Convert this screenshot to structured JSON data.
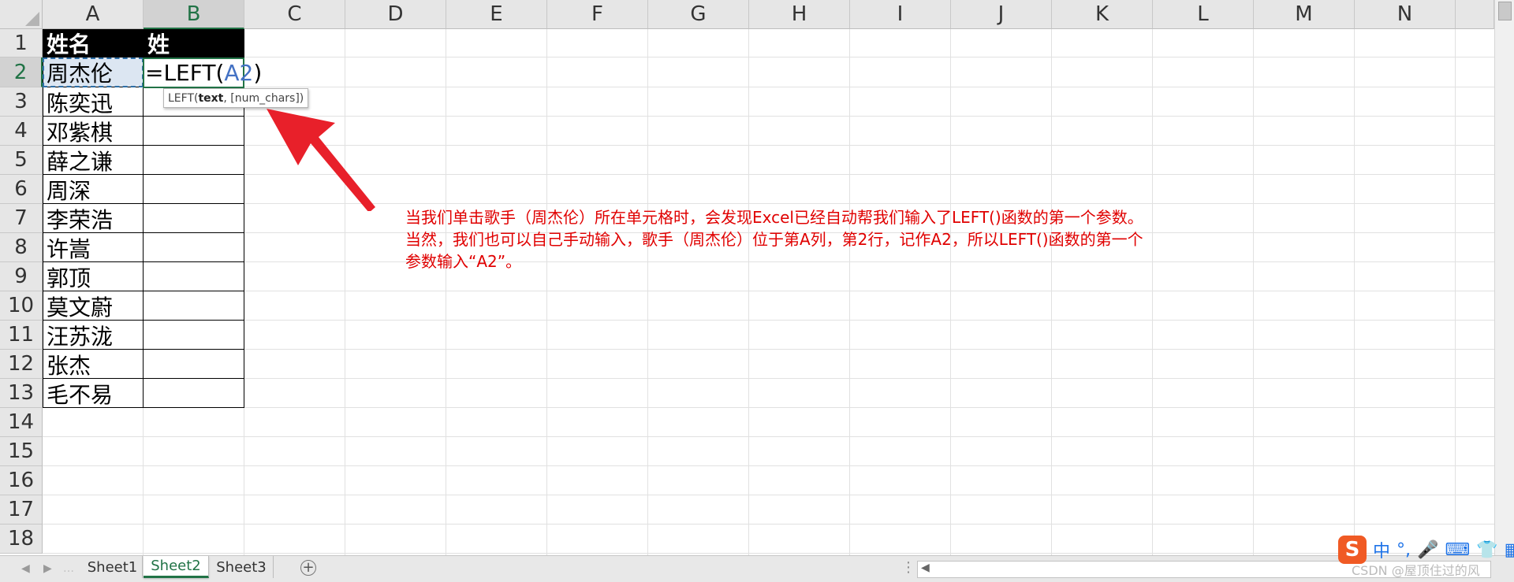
{
  "columns": [
    "A",
    "B",
    "C",
    "D",
    "E",
    "F",
    "G",
    "H",
    "I",
    "J",
    "K",
    "L",
    "M",
    "N"
  ],
  "rows": [
    "1",
    "2",
    "3",
    "4",
    "5",
    "6",
    "7",
    "8",
    "9",
    "10",
    "11",
    "12",
    "13",
    "14",
    "15",
    "16",
    "17",
    "18"
  ],
  "header_row": {
    "a1": "姓名",
    "b1": "姓"
  },
  "names": [
    "周杰伦",
    "陈奕迅",
    "邓紫棋",
    "薛之谦",
    "周深",
    "李荣浩",
    "许嵩",
    "郭顶",
    "莫文蔚",
    "汪苏泷",
    "张杰",
    "毛不易"
  ],
  "formula": {
    "prefix": "=LEFT(",
    "ref": "A2",
    "suffix": ")"
  },
  "tooltip": {
    "fn": "LEFT(",
    "arg1": "text",
    "rest": ", [num_chars])"
  },
  "annotation": [
    "当我们单击歌手（周杰伦）所在单元格时，会发现Excel已经自动帮我们输入了LEFT()函数的第一个参数。",
    "当然，我们也可以自己手动输入，歌手（周杰伦）位于第A列，第2行，记作A2，所以LEFT()函数的第一个",
    "参数输入“A2”。"
  ],
  "sheets": [
    "Sheet1",
    "Sheet2",
    "Sheet3"
  ],
  "active_sheet": "Sheet2",
  "add_sheet": "+",
  "ime": {
    "logo": "S",
    "lang": "中",
    "punct": "°,"
  },
  "watermark": "CSDN @屋顶住过的风",
  "colors": {
    "accent": "#217346",
    "annotation": "#e00000",
    "arrow": "#e8202a",
    "ref": "#4472c4"
  }
}
